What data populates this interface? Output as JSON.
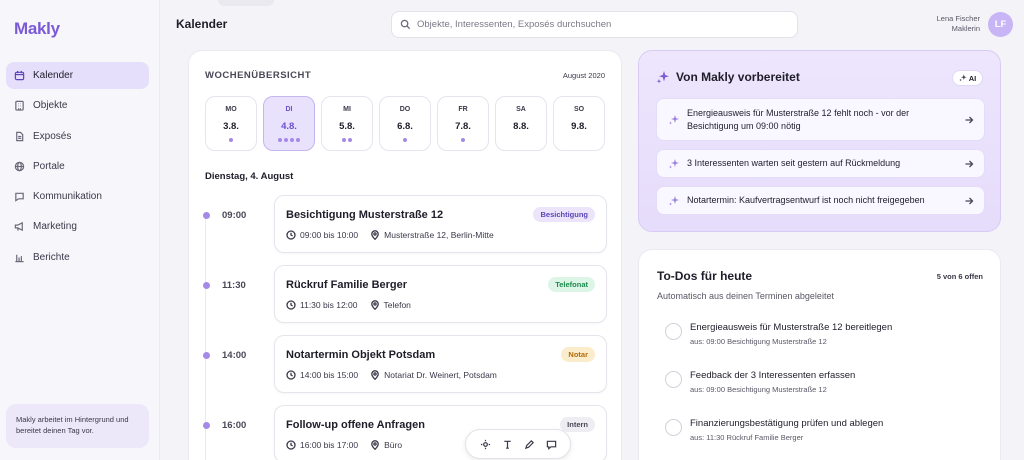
{
  "app": {
    "name": "Makly"
  },
  "sidebar": {
    "items": [
      {
        "label": "Kalender",
        "icon": "calendar-icon",
        "active": true
      },
      {
        "label": "Objekte",
        "icon": "building-icon",
        "active": false
      },
      {
        "label": "Exposés",
        "icon": "document-icon",
        "active": false
      },
      {
        "label": "Portale",
        "icon": "globe-icon",
        "active": false
      },
      {
        "label": "Kommunikation",
        "icon": "chat-icon",
        "active": false
      },
      {
        "label": "Marketing",
        "icon": "megaphone-icon",
        "active": false
      },
      {
        "label": "Berichte",
        "icon": "bar-chart-icon",
        "active": false
      }
    ],
    "note": "Makly arbeitet im Hintergrund und bereitet deinen Tag vor."
  },
  "header": {
    "title": "Kalender",
    "search_placeholder": "Objekte, Interessenten, Exposés durchsuchen",
    "user_name": "Lena Fischer",
    "user_role": "Maklerin",
    "user_initials": "LF"
  },
  "calendar": {
    "heading": "WOCHENÜBERSICHT",
    "month": "August 2020",
    "days": [
      {
        "name": "MO",
        "date": "3.8.",
        "dots": 1,
        "active": false
      },
      {
        "name": "DI",
        "date": "4.8.",
        "dots": 4,
        "active": true
      },
      {
        "name": "MI",
        "date": "5.8.",
        "dots": 2,
        "active": false
      },
      {
        "name": "DO",
        "date": "6.8.",
        "dots": 1,
        "active": false
      },
      {
        "name": "FR",
        "date": "7.8.",
        "dots": 1,
        "active": false
      },
      {
        "name": "SA",
        "date": "8.8.",
        "dots": 0,
        "active": false
      },
      {
        "name": "SO",
        "date": "9.8.",
        "dots": 0,
        "active": false
      }
    ],
    "selected_date": "Dienstag, 4. August",
    "events": [
      {
        "time": "09:00",
        "title": "Besichtigung Musterstraße 12",
        "tag": "Besichtigung",
        "tag_color": "#5b45b8",
        "duration": "09:00 bis 10:00",
        "location": "Musterstraße 12, Berlin-Mitte"
      },
      {
        "time": "11:30",
        "title": "Rückruf Familie Berger",
        "tag": "Telefonat",
        "tag_color": "#1e8a4d",
        "duration": "11:30 bis 12:00",
        "location": "Telefon"
      },
      {
        "time": "14:00",
        "title": "Notartermin Objekt Potsdam",
        "tag": "Notar",
        "tag_color": "#b26c0a",
        "duration": "14:00 bis 15:00",
        "location": "Notariat Dr. Weinert, Potsdam"
      },
      {
        "time": "16:00",
        "title": "Follow-up offene Anfragen",
        "tag": "Intern",
        "tag_color": "#4a4757",
        "duration": "16:00 bis 17:00",
        "location": "Büro"
      }
    ]
  },
  "ai": {
    "title": "Von Makly vorbereitet",
    "badge": "AI",
    "items": [
      "Energieausweis für Musterstraße 12 fehlt noch - vor der Besichtigung um 09:00 nötig",
      "3 Interessenten warten seit gestern auf Rückmeldung",
      "Notartermin: Kaufvertragsentwurf ist noch nicht freigegeben"
    ]
  },
  "todos": {
    "title": "To-Dos für heute",
    "count": "5 von 6 offen",
    "subtitle": "Automatisch aus deinen Terminen abgeleitet",
    "items": [
      {
        "text": "Energieausweis für Musterstraße 12 bereitlegen",
        "source": "aus: 09:00 Besichtigung Musterstraße 12"
      },
      {
        "text": "Feedback der 3 Interessenten erfassen",
        "source": "aus: 09:00 Besichtigung Musterstraße 12"
      },
      {
        "text": "Finanzierungsbestätigung prüfen und ablegen",
        "source": "aus: 11:30 Rückruf Familie Berger"
      }
    ]
  },
  "toolbar": {
    "icons": [
      "select-icon",
      "text-icon",
      "pen-icon",
      "comment-icon"
    ]
  },
  "colors": {
    "accent": "#7a5ad6",
    "accent_light": "#e6dffb",
    "background": "#f4f3f7"
  }
}
